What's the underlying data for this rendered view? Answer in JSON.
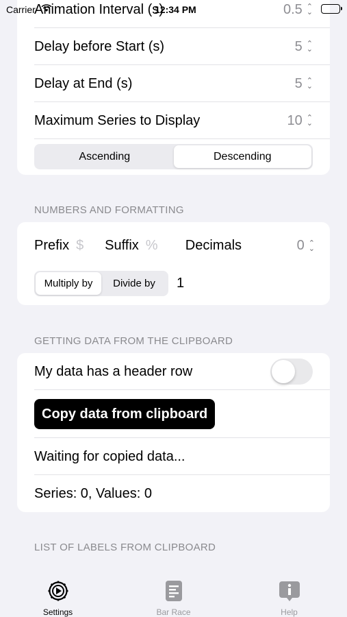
{
  "status_bar": {
    "carrier": "Carrier",
    "time": "12:34 PM"
  },
  "animation_group": {
    "rows": [
      {
        "label": "Animation Interval (s)",
        "value": "0.5"
      },
      {
        "label": "Delay before Start (s)",
        "value": "5"
      },
      {
        "label": "Delay at End (s)",
        "value": "5"
      },
      {
        "label": "Maximum Series to Display",
        "value": "10"
      }
    ],
    "sort_options": [
      "Ascending",
      "Descending"
    ],
    "sort_selected": "Descending"
  },
  "formatting": {
    "header": "NUMBERS AND FORMATTING",
    "prefix_label": "Prefix",
    "prefix_placeholder": "$",
    "suffix_label": "Suffix",
    "suffix_placeholder": "%",
    "decimals_label": "Decimals",
    "decimals_value": "0",
    "multiply_options": [
      "Multiply by",
      "Divide by"
    ],
    "multiply_selected": "Multiply by",
    "factor_value": "1"
  },
  "clipboard": {
    "header": "GETTING DATA FROM THE CLIPBOARD",
    "header_row_label": "My data has a header row",
    "header_row_enabled": false,
    "copy_button": "Copy data from clipboard",
    "status": "Waiting for copied data...",
    "summary": "Series: 0, Values: 0"
  },
  "labels_section": {
    "header": "LIST OF LABELS FROM CLIPBOARD"
  },
  "tabbar": {
    "tabs": [
      {
        "label": "Settings",
        "icon": "gear-icon",
        "active": true
      },
      {
        "label": "Bar Race",
        "icon": "document-icon",
        "active": false
      },
      {
        "label": "Help",
        "icon": "info-bubble-icon",
        "active": false
      }
    ]
  },
  "colors": {
    "background": "#f2f2f7",
    "card": "#ffffff",
    "secondary_text": "#8e8e93",
    "button_black": "#000000"
  }
}
